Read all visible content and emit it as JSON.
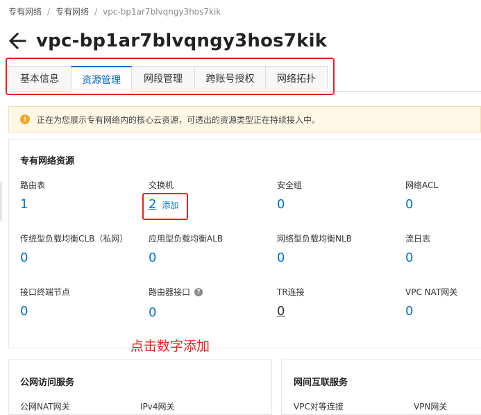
{
  "breadcrumb": {
    "item1": "专有网络",
    "item2": "专有网络",
    "current": "vpc-bp1ar7blvqngy3hos7kik",
    "separator": "/"
  },
  "page_title": "vpc-bp1ar7blvqngy3hos7kik",
  "tabs": [
    {
      "label": "基本信息",
      "active": false
    },
    {
      "label": "资源管理",
      "active": true
    },
    {
      "label": "网段管理",
      "active": false
    },
    {
      "label": "跨账号授权",
      "active": false
    },
    {
      "label": "网络拓扑",
      "active": false
    }
  ],
  "notice": {
    "icon": "warning-icon",
    "text": "正在为您展示专有网络内的核心云资源，可透出的资源类型正在持续接入中。"
  },
  "resources": {
    "title": "专有网络资源",
    "items": [
      {
        "label": "路由表",
        "value": "1"
      },
      {
        "label": "交换机",
        "value": "2",
        "action": "添加"
      },
      {
        "label": "安全组",
        "value": "0"
      },
      {
        "label": "网络ACL",
        "value": "0"
      },
      {
        "label": "传统型负载均衡CLB（私网）",
        "value": "0"
      },
      {
        "label": "应用型负载均衡ALB",
        "value": "0"
      },
      {
        "label": "网络型负载均衡NLB",
        "value": "0"
      },
      {
        "label": "流日志",
        "value": "0"
      },
      {
        "label": "接口终端节点",
        "value": "0"
      },
      {
        "label": "路由器接口",
        "value": "0",
        "help_icon": "question-icon"
      },
      {
        "label": "TR连接",
        "value": "0"
      },
      {
        "label": "VPC NAT网关",
        "value": "0"
      }
    ]
  },
  "annotation": "点击数字添加",
  "public_access": {
    "title": "公网访问服务",
    "items": [
      "公网NAT网关",
      "IPv4网关"
    ]
  },
  "interconnect": {
    "title": "网间互联服务",
    "items": [
      "VPC对等连接",
      "VPN网关"
    ]
  },
  "colors": {
    "accent": "#0070cc",
    "highlight": "#e8211f",
    "notice_bg": "#fff8e6"
  }
}
